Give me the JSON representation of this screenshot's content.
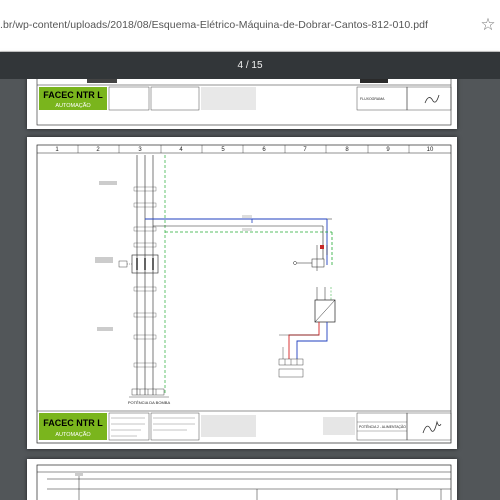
{
  "browser": {
    "url": ".br/wp-content/uploads/2018/08/Esquema-Elétrico-Máquina-de-Dobrar-Cantos-812-010.pdf",
    "star_icon": "bookmark-star-icon"
  },
  "pdf_viewer": {
    "page_counter": "4 / 15"
  },
  "title_block": {
    "logo_text": "FACEC NTR L",
    "logo_sub": "AUTOMAÇÃO",
    "page3_project": "POTÊNCIA 2 - ALIMENTAÇÃO",
    "page2_project": "FLUXOGRAMA"
  },
  "schematic": {
    "columns": [
      "1",
      "2",
      "3",
      "4",
      "5",
      "6",
      "7",
      "8",
      "9",
      "10"
    ],
    "pump_label": "POTÊNCIA DA BOMBA"
  },
  "colors": {
    "toolbar": "#323639",
    "viewer_bg": "#525659",
    "logo_green": "#7ab51d",
    "wire_blue": "#1f3fbf",
    "wire_green": "#22aa33",
    "wire_red": "#d62020"
  }
}
